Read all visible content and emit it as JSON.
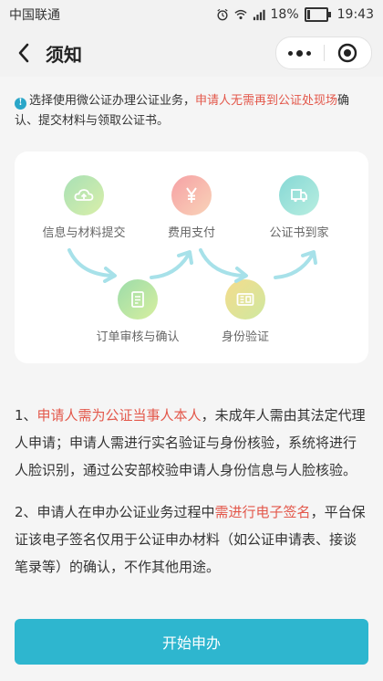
{
  "status_bar": {
    "carrier": "中国联通",
    "battery": "18%",
    "time": "19:43",
    "icons": [
      "alarm-icon",
      "wifi-icon",
      "signal-icon",
      "battery-icon"
    ]
  },
  "nav": {
    "title": "须知",
    "back_icon": "chevron-left-icon",
    "more_icon": "more-dots-icon",
    "close_icon": "record-circle-icon"
  },
  "notice": {
    "part1": "选择使用微公证办理公证业务，",
    "highlight": "申请人无需再到公证处现场",
    "part2": "确认、提交材料与领取公证书。"
  },
  "flow": {
    "steps": [
      {
        "label": "信息与材料提交",
        "icon": "cloud-upload-icon"
      },
      {
        "label": "费用支付",
        "icon": "yen-icon"
      },
      {
        "label": "公证书到家",
        "icon": "delivery-truck-icon"
      },
      {
        "label": "订单审核与确认",
        "icon": "document-check-icon"
      },
      {
        "label": "身份验证",
        "icon": "id-card-icon"
      }
    ]
  },
  "rules": [
    {
      "prefix": "1、",
      "highlight": "申请人需为公证当事人本人",
      "suffix": "，未成年人需由其法定代理人申请；申请人需进行实名验证与身份核验，系统将进行人脸识别，通过公安部校验申请人身份信息与人脸核验。"
    },
    {
      "prefix": "2、申请人在申办公证业务过程中",
      "highlight": "需进行电子签名",
      "suffix": "，平台保证该电子签名仅用于公证申办材料（如公证申请表、接谈笔录等）的确认，不作其他用途。"
    }
  ],
  "start_button": "开始申办",
  "colors": {
    "accent": "#2eb6cf",
    "highlight_red": "#e3574a",
    "info_icon": "#2aa6c8"
  }
}
